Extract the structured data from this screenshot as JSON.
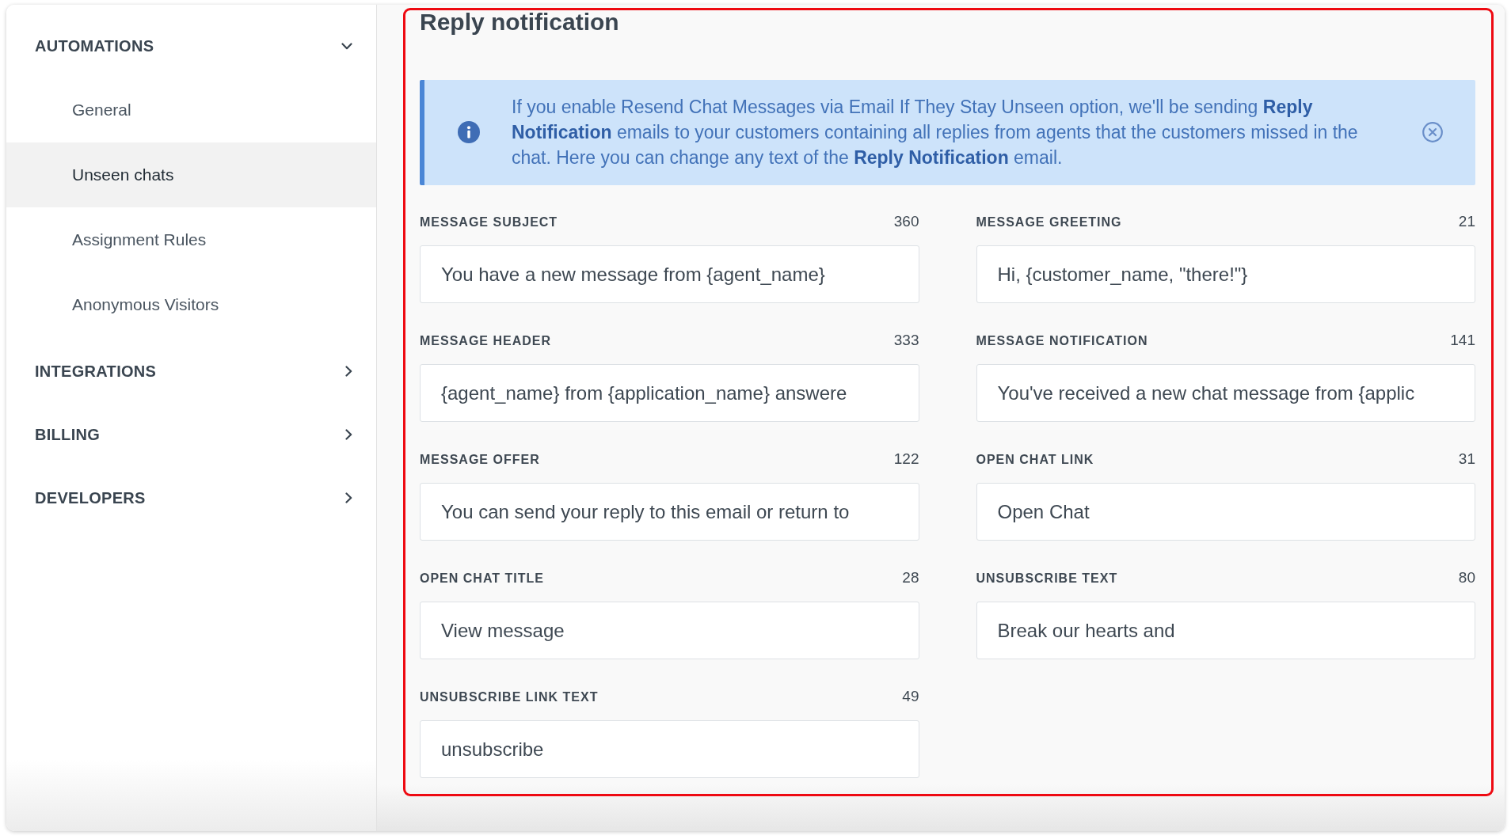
{
  "sidebar": {
    "sections": [
      {
        "label": "AUTOMATIONS",
        "expanded": true,
        "items": [
          {
            "label": "General",
            "selected": false
          },
          {
            "label": "Unseen chats",
            "selected": true
          },
          {
            "label": "Assignment Rules",
            "selected": false
          },
          {
            "label": "Anonymous Visitors",
            "selected": false
          }
        ]
      },
      {
        "label": "INTEGRATIONS",
        "expanded": false
      },
      {
        "label": "BILLING",
        "expanded": false
      },
      {
        "label": "DEVELOPERS",
        "expanded": false
      }
    ]
  },
  "page": {
    "title": "Reply notification",
    "notice": {
      "text": "If you enable Resend Chat Messages via Email If They Stay Unseen option, we'll be sending **Reply Notification** emails to your customers containing all replies from agents that the customers missed in the chat. Here you can change any text of the **Reply Notification** email."
    },
    "fields": [
      {
        "label": "MESSAGE SUBJECT",
        "count": "360",
        "value": "You have a new message from {agent_name}"
      },
      {
        "label": "MESSAGE GREETING",
        "count": "21",
        "value": "Hi, {customer_name, \"there!\"}"
      },
      {
        "label": "MESSAGE HEADER",
        "count": "333",
        "value": "{agent_name} from {application_name} answere"
      },
      {
        "label": "MESSAGE NOTIFICATION",
        "count": "141",
        "value": "You've received a new chat message from {applic"
      },
      {
        "label": "MESSAGE OFFER",
        "count": "122",
        "value": "You can send your reply to this email or return to"
      },
      {
        "label": "OPEN CHAT LINK",
        "count": "31",
        "value": "Open Chat"
      },
      {
        "label": "OPEN CHAT TITLE",
        "count": "28",
        "value": "View message"
      },
      {
        "label": "UNSUBSCRIBE TEXT",
        "count": "80",
        "value": "Break our hearts and"
      },
      {
        "label": "UNSUBSCRIBE LINK TEXT",
        "count": "49",
        "value": "unsubscribe"
      }
    ]
  }
}
